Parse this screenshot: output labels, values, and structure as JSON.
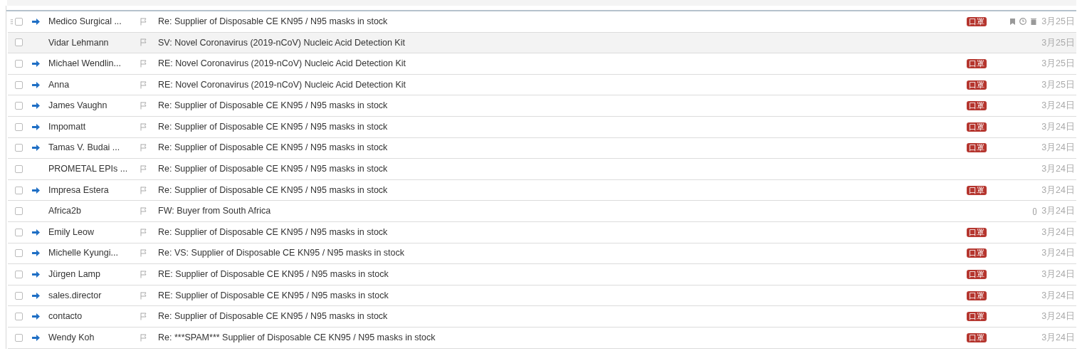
{
  "rows": [
    {
      "sender": "Medico Surgical ...",
      "subject": "Re: Supplier of Disposable CE KN95 / N95 masks in stock",
      "replied": true,
      "tag": "口罩",
      "date": "3月25日",
      "highlighted": false,
      "actions_shown": true,
      "attachment": false
    },
    {
      "sender": "Vidar Lehmann",
      "subject": "SV: Novel Coronavirus (2019-nCoV) Nucleic Acid Detection Kit",
      "replied": false,
      "date": "3月25日",
      "highlighted": true,
      "actions_shown": false,
      "attachment": false
    },
    {
      "sender": "Michael Wendlin...",
      "subject": "RE: Novel Coronavirus (2019-nCoV) Nucleic Acid Detection Kit",
      "replied": true,
      "tag": "口罩",
      "date": "3月25日",
      "highlighted": false,
      "actions_shown": false,
      "attachment": false
    },
    {
      "sender": "Anna",
      "subject": "RE: Novel Coronavirus (2019-nCoV) Nucleic Acid Detection Kit",
      "replied": true,
      "tag": "口罩",
      "date": "3月25日",
      "highlighted": false,
      "actions_shown": false,
      "attachment": false
    },
    {
      "sender": "James Vaughn",
      "subject": "Re: Supplier of Disposable CE KN95 / N95 masks in stock",
      "replied": true,
      "tag": "口罩",
      "date": "3月24日",
      "highlighted": false,
      "actions_shown": false,
      "attachment": false
    },
    {
      "sender": "Impomatt",
      "subject": "Re: Supplier of Disposable CE KN95 / N95 masks in stock",
      "replied": true,
      "tag": "口罩",
      "date": "3月24日",
      "highlighted": false,
      "actions_shown": false,
      "attachment": false
    },
    {
      "sender": "Tamas V. Budai ...",
      "subject": "Re: Supplier of Disposable CE KN95 / N95 masks in stock",
      "replied": true,
      "tag": "口罩",
      "date": "3月24日",
      "highlighted": false,
      "actions_shown": false,
      "attachment": false
    },
    {
      "sender": "PROMETAL EPIs ...",
      "subject": "Re: Supplier of Disposable CE KN95 / N95 masks in stock",
      "replied": false,
      "date": "3月24日",
      "highlighted": false,
      "actions_shown": false,
      "attachment": false
    },
    {
      "sender": "Impresa Estera",
      "subject": "Re: Supplier of Disposable CE KN95 / N95 masks in stock",
      "replied": true,
      "tag": "口罩",
      "date": "3月24日",
      "highlighted": false,
      "actions_shown": false,
      "attachment": false
    },
    {
      "sender": "Africa2b",
      "subject": "FW: Buyer from South Africa",
      "replied": false,
      "date": "3月24日",
      "highlighted": false,
      "actions_shown": false,
      "attachment": true
    },
    {
      "sender": "Emily Leow",
      "subject": "Re: Supplier of Disposable CE KN95 / N95 masks in stock",
      "replied": true,
      "tag": "口罩",
      "date": "3月24日",
      "highlighted": false,
      "actions_shown": false,
      "attachment": false
    },
    {
      "sender": "Michelle Kyungi...",
      "subject": "Re: VS: Supplier of Disposable CE KN95 / N95 masks in stock",
      "replied": true,
      "tag": "口罩",
      "date": "3月24日",
      "highlighted": false,
      "actions_shown": false,
      "attachment": false
    },
    {
      "sender": "Jürgen Lamp",
      "subject": "RE: Supplier of Disposable CE KN95 / N95 masks in stock",
      "replied": true,
      "tag": "口罩",
      "date": "3月24日",
      "highlighted": false,
      "actions_shown": false,
      "attachment": false
    },
    {
      "sender": "sales.director",
      "subject": "RE: Supplier of Disposable CE KN95 / N95 masks in stock",
      "replied": true,
      "tag": "口罩",
      "date": "3月24日",
      "highlighted": false,
      "actions_shown": false,
      "attachment": false
    },
    {
      "sender": "contacto",
      "subject": "Re: Supplier of Disposable CE KN95 / N95 masks in stock",
      "replied": true,
      "tag": "口罩",
      "date": "3月24日",
      "highlighted": false,
      "actions_shown": false,
      "attachment": false
    },
    {
      "sender": "Wendy Koh",
      "subject": "Re: ***SPAM*** Supplier of Disposable CE KN95 / N95 masks in stock",
      "replied": true,
      "tag": "口罩",
      "date": "3月24日",
      "highlighted": false,
      "actions_shown": false,
      "attachment": false
    }
  ]
}
